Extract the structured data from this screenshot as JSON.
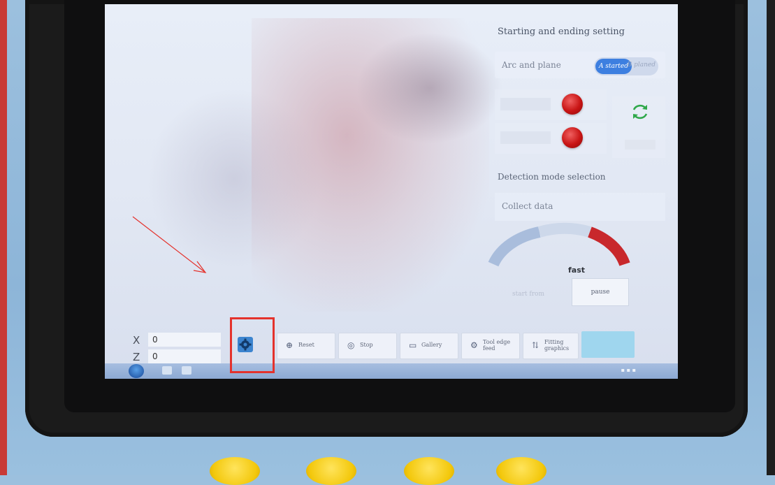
{
  "panel": {
    "title": "Starting and ending setting",
    "arc_label": "Arc and plane",
    "toggle_on": "A started",
    "toggle_off": "B planed",
    "detection_title": "Detection mode selection",
    "collect_label": "Collect data",
    "speed_label": "fast",
    "start_label": "start from",
    "pause_label": "pause"
  },
  "coords": {
    "x_axis": "X",
    "x_value": "0",
    "z_axis": "Z",
    "z_value": "0"
  },
  "toolbar": {
    "reset": "Reset",
    "stop": "Stop",
    "gallery": "Gallery",
    "tool": "Tool edge feed",
    "fitting": "Fitting graphics"
  },
  "colors": {
    "accent": "#3d7fe0",
    "highlight": "#e4322c",
    "led": "#c81414",
    "refresh": "#2fa84a"
  }
}
